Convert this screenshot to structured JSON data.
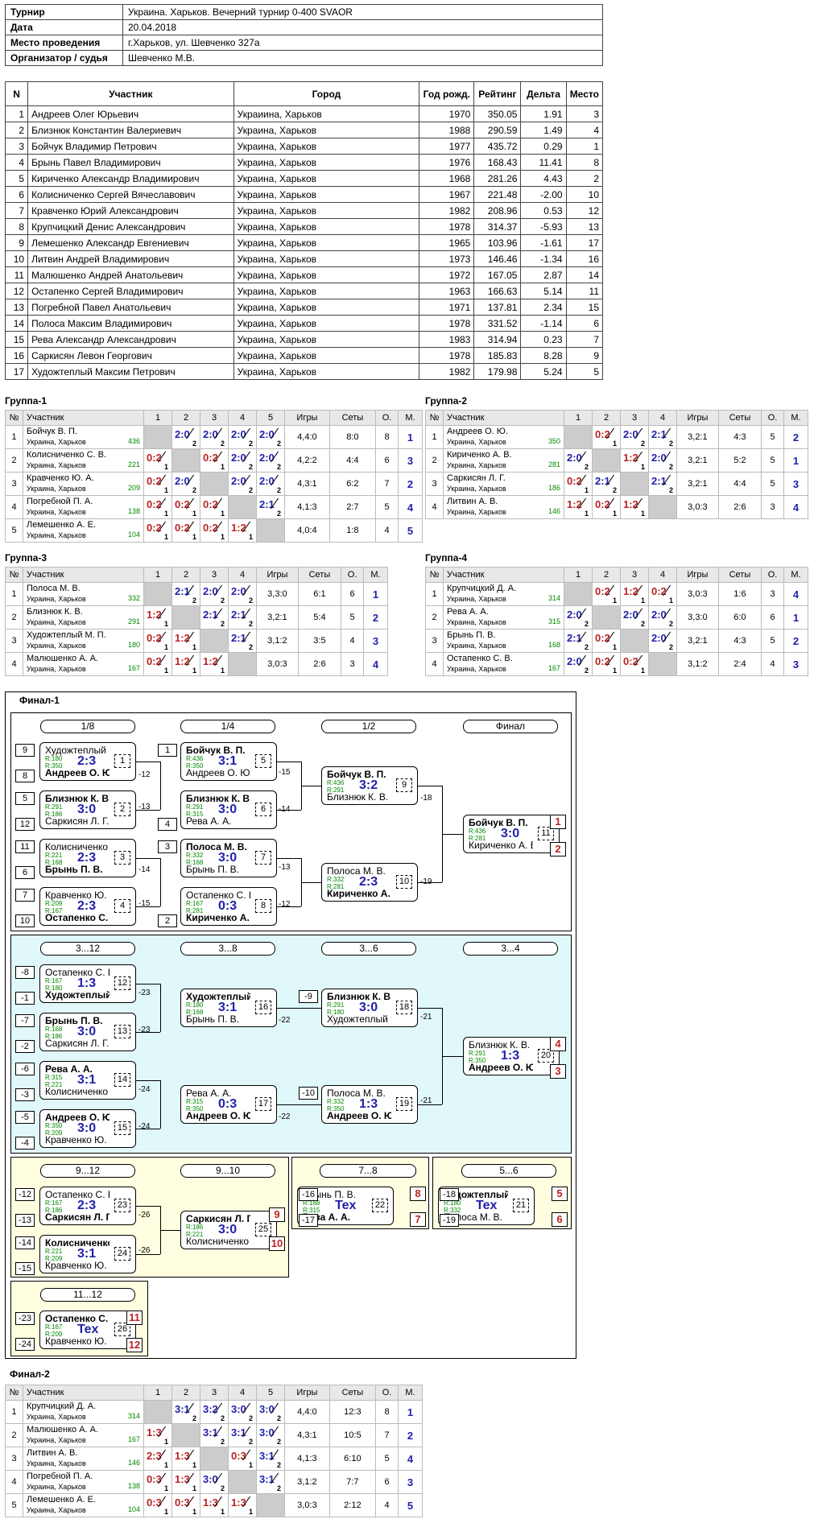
{
  "info": {
    "rows": [
      {
        "k": "Турнир",
        "v": "Украина. Харьков. Вечерний турнир 0-400 SVAOR"
      },
      {
        "k": "Дата",
        "v": "20.04.2018"
      },
      {
        "k": "Место проведения",
        "v": "г.Харьков, ул. Шевченко 327а"
      },
      {
        "k": "Организатор / судья",
        "v": "Шевченко М.В."
      }
    ]
  },
  "participants": {
    "headers": [
      "N",
      "Участник",
      "Город",
      "Год рожд.",
      "Рейтинг",
      "Дельта",
      "Место"
    ],
    "rows": [
      [
        "1",
        "Андреев Олег Юрьевич",
        "Украиина, Харьков",
        "1970",
        "350.05",
        "1.91",
        "3"
      ],
      [
        "2",
        "Близнюк Константин Валериевич",
        "Украина, Харьков",
        "1988",
        "290.59",
        "1.49",
        "4"
      ],
      [
        "3",
        "Бойчук Владимир Петрович",
        "Украина, Харьков",
        "1977",
        "435.72",
        "0.29",
        "1"
      ],
      [
        "4",
        "Брынь Павел Владимирович",
        "Украина, Харьков",
        "1976",
        "168.43",
        "11.41",
        "8"
      ],
      [
        "5",
        "Кириченко Александр Владимирович",
        "Украина, Харьков",
        "1968",
        "281.26",
        "4.43",
        "2"
      ],
      [
        "6",
        "Колисниченко Сергей Вячеславович",
        "Украина, Харьков",
        "1967",
        "221.48",
        "-2.00",
        "10"
      ],
      [
        "7",
        "Кравченко Юрий Александрович",
        "Украина, Харьков",
        "1982",
        "208.96",
        "0.53",
        "12"
      ],
      [
        "8",
        "Крупчицкий Денис Александрович",
        "Украина, Харьков",
        "1978",
        "314.37",
        "-5.93",
        "13"
      ],
      [
        "9",
        "Лемешенко Александр Евгениевич",
        "Украина, Харьков",
        "1965",
        "103.96",
        "-1.61",
        "17"
      ],
      [
        "10",
        "Литвин Андрей Владимирович",
        "Украина, Харьков",
        "1973",
        "146.46",
        "-1.34",
        "16"
      ],
      [
        "11",
        "Малюшенко Андрей Анатольевич",
        "Украина, Харьков",
        "1972",
        "167.05",
        "2.87",
        "14"
      ],
      [
        "12",
        "Остапенко Сергей Владимирович",
        "Украина, Харьков",
        "1963",
        "166.63",
        "5.14",
        "11"
      ],
      [
        "13",
        "Погребной Павел Анатольевич",
        "Украина, Харьков",
        "1971",
        "137.81",
        "2.34",
        "15"
      ],
      [
        "14",
        "Полоса Максим Владимирович",
        "Украина, Харьков",
        "1978",
        "331.52",
        "-1.14",
        "6"
      ],
      [
        "15",
        "Рева Александр Александрович",
        "Украина, Харьков",
        "1983",
        "314.94",
        "0.23",
        "7"
      ],
      [
        "16",
        "Саркисян Левон Георгович",
        "Украина, Харьков",
        "1978",
        "185.83",
        "8.28",
        "9"
      ],
      [
        "17",
        "Художтеплый Максим Петрович",
        "Украина, Харьков",
        "1982",
        "179.98",
        "5.24",
        "5"
      ]
    ]
  },
  "groups": [
    {
      "title": "Группа-1",
      "n": 5,
      "rows": [
        {
          "no": "1",
          "name": "Бойчук В. П.",
          "city": "Украина, Харьков",
          "r": "436",
          "cells": [
            null,
            "2:0|2",
            "2:0|2",
            "2:0|2",
            "2:0|2"
          ],
          "games": "4,4:0",
          "sets": "8:0",
          "o": "8",
          "m": "1"
        },
        {
          "no": "2",
          "name": "Колисниченко С. В.",
          "city": "Украина, Харьков",
          "r": "221",
          "cells": [
            "0:2|1",
            null,
            "0:2|1",
            "2:0|2",
            "2:0|2"
          ],
          "games": "4,2:2",
          "sets": "4:4",
          "o": "6",
          "m": "3"
        },
        {
          "no": "3",
          "name": "Кравченко Ю. А.",
          "city": "Украина, Харьков",
          "r": "209",
          "cells": [
            "0:2|1",
            "2:0|2",
            null,
            "2:0|2",
            "2:0|2"
          ],
          "games": "4,3:1",
          "sets": "6:2",
          "o": "7",
          "m": "2"
        },
        {
          "no": "4",
          "name": "Погребной П. А.",
          "city": "Украина, Харьков",
          "r": "138",
          "cells": [
            "0:2|1",
            "0:2|1",
            "0:2|1",
            null,
            "2:1|2"
          ],
          "games": "4,1:3",
          "sets": "2:7",
          "o": "5",
          "m": "4"
        },
        {
          "no": "5",
          "name": "Лемешенко А. Е.",
          "city": "Украина, Харьков",
          "r": "104",
          "cells": [
            "0:2|1",
            "0:2|1",
            "0:2|1",
            "1:2|1",
            null
          ],
          "games": "4,0:4",
          "sets": "1:8",
          "o": "4",
          "m": "5"
        }
      ]
    },
    {
      "title": "Группа-2",
      "n": 4,
      "rows": [
        {
          "no": "1",
          "name": "Андреев О. Ю.",
          "city": "Украина, Харьков",
          "r": "350",
          "cells": [
            null,
            "0:2|1",
            "2:0|2",
            "2:1|2"
          ],
          "games": "3,2:1",
          "sets": "4:3",
          "o": "5",
          "m": "2"
        },
        {
          "no": "2",
          "name": "Кириченко А. В.",
          "city": "Украина, Харьков",
          "r": "281",
          "cells": [
            "2:0|2",
            null,
            "1:2|1",
            "2:0|2"
          ],
          "games": "3,2:1",
          "sets": "5:2",
          "o": "5",
          "m": "1"
        },
        {
          "no": "3",
          "name": "Саркисян Л. Г.",
          "city": "Украина, Харьков",
          "r": "186",
          "cells": [
            "0:2|1",
            "2:1|2",
            null,
            "2:1|2"
          ],
          "games": "3,2:1",
          "sets": "4:4",
          "o": "5",
          "m": "3"
        },
        {
          "no": "4",
          "name": "Литвин А. В.",
          "city": "Украина, Харьков",
          "r": "146",
          "cells": [
            "1:2|1",
            "0:2|1",
            "1:2|1",
            null
          ],
          "games": "3,0:3",
          "sets": "2:6",
          "o": "3",
          "m": "4"
        }
      ]
    },
    {
      "title": "Группа-3",
      "n": 4,
      "rows": [
        {
          "no": "1",
          "name": "Полоса М. В.",
          "city": "Украина, Харьков",
          "r": "332",
          "cells": [
            null,
            "2:1|2",
            "2:0|2",
            "2:0|2"
          ],
          "games": "3,3:0",
          "sets": "6:1",
          "o": "6",
          "m": "1"
        },
        {
          "no": "2",
          "name": "Близнюк К. В.",
          "city": "Украина, Харьков",
          "r": "291",
          "cells": [
            "1:2|1",
            null,
            "2:1|2",
            "2:1|2"
          ],
          "games": "3,2:1",
          "sets": "5:4",
          "o": "5",
          "m": "2"
        },
        {
          "no": "3",
          "name": "Художтеплый М. П.",
          "city": "Украина, Харьков",
          "r": "180",
          "cells": [
            "0:2|1",
            "1:2|1",
            null,
            "2:1|2"
          ],
          "games": "3,1:2",
          "sets": "3:5",
          "o": "4",
          "m": "3"
        },
        {
          "no": "4",
          "name": "Малюшенко А. А.",
          "city": "Украина, Харьков",
          "r": "167",
          "cells": [
            "0:2|1",
            "1:2|1",
            "1:2|1",
            null
          ],
          "games": "3,0:3",
          "sets": "2:6",
          "o": "3",
          "m": "4"
        }
      ]
    },
    {
      "title": "Группа-4",
      "n": 4,
      "rows": [
        {
          "no": "1",
          "name": "Крупчицкий Д. А.",
          "city": "Украина, Харьков",
          "r": "314",
          "cells": [
            null,
            "0:2|1",
            "1:2|1",
            "0:2|1"
          ],
          "games": "3,0:3",
          "sets": "1:6",
          "o": "3",
          "m": "4"
        },
        {
          "no": "2",
          "name": "Рева А. А.",
          "city": "Украина, Харьков",
          "r": "315",
          "cells": [
            "2:0|2",
            null,
            "2:0|2",
            "2:0|2"
          ],
          "games": "3,3:0",
          "sets": "6:0",
          "o": "6",
          "m": "1"
        },
        {
          "no": "3",
          "name": "Брынь П. В.",
          "city": "Украина, Харьков",
          "r": "168",
          "cells": [
            "2:1|2",
            "0:2|1",
            null,
            "2:0|2"
          ],
          "games": "3,2:1",
          "sets": "4:3",
          "o": "5",
          "m": "2"
        },
        {
          "no": "4",
          "name": "Остапенко С. В.",
          "city": "Украина, Харьков",
          "r": "167",
          "cells": [
            "2:0|2",
            "0:2|1",
            "0:2|1",
            null
          ],
          "games": "3,1:2",
          "sets": "2:4",
          "o": "4",
          "m": "3"
        }
      ]
    },
    {
      "title": "Финал-2",
      "n": 5,
      "rows": [
        {
          "no": "1",
          "name": "Крупчицкий Д. А.",
          "city": "Украина, Харьков",
          "r": "314",
          "cells": [
            null,
            "3:1|2",
            "3:2|2",
            "3:0|2",
            "3:0|2"
          ],
          "games": "4,4:0",
          "sets": "12:3",
          "o": "8",
          "m": "1"
        },
        {
          "no": "2",
          "name": "Малюшенко А. А.",
          "city": "Украина, Харьков",
          "r": "167",
          "cells": [
            "1:3|1",
            null,
            "3:1|2",
            "3:1|2",
            "3:0|2"
          ],
          "games": "4,3:1",
          "sets": "10:5",
          "o": "7",
          "m": "2"
        },
        {
          "no": "3",
          "name": "Литвин А. В.",
          "city": "Украина, Харьков",
          "r": "146",
          "cells": [
            "2:3|1",
            "1:3|1",
            null,
            "0:3|1",
            "3:1|2"
          ],
          "games": "4,1:3",
          "sets": "6:10",
          "o": "5",
          "m": "4"
        },
        {
          "no": "4",
          "name": "Погребной П. А.",
          "city": "Украина, Харьков",
          "r": "138",
          "cells": [
            "0:3|1",
            "1:3|1",
            "3:0|2",
            null,
            "3:1|2"
          ],
          "games": "3,1:2",
          "sets": "7:7",
          "o": "6",
          "m": "3"
        },
        {
          "no": "5",
          "name": "Лемешенко А. Е.",
          "city": "Украина, Харьков",
          "r": "104",
          "cells": [
            "0:3|1",
            "0:3|1",
            "1:3|1",
            "1:3|1",
            null
          ],
          "games": "3,0:3",
          "sets": "2:12",
          "o": "4",
          "m": "5"
        }
      ]
    }
  ],
  "group_headers": {
    "n": "№",
    "name": "Участник",
    "games": "Игры",
    "sets": "Сеты",
    "o": "О.",
    "m": "М."
  },
  "final1": {
    "title": "Финал-1",
    "rounds": [
      "1/8",
      "1/4",
      "1/2",
      "Финал",
      "3...12",
      "3...8",
      "3...6",
      "3...4",
      "9...12",
      "9...10",
      "7...8",
      "5...6",
      "11...12"
    ],
    "matches": [
      {
        "p1": "Художтеплый М...",
        "p2": "Андреев О. Ю.",
        "r1": "R:180",
        "r2": "R:350",
        "s": "2:3",
        "n": "1",
        "b": 2
      },
      {
        "p1": "Близнюк К. В.",
        "p2": "Саркисян Л. Г.",
        "r1": "R:291",
        "r2": "R:186",
        "s": "3:0",
        "n": "2",
        "b": 1
      },
      {
        "p1": "Колисниченко ...",
        "p2": "Брынь П. В.",
        "r1": "R:221",
        "r2": "R:168",
        "s": "2:3",
        "n": "3",
        "b": 2
      },
      {
        "p1": "Кравченко Ю. А.",
        "p2": "Остапенко С. В.",
        "r1": "R:209",
        "r2": "R:167",
        "s": "2:3",
        "n": "4",
        "b": 2
      },
      {
        "p1": "Бойчук В. П.",
        "p2": "Андреев О. Ю.",
        "r1": "R:436",
        "r2": "R:350",
        "s": "3:1",
        "n": "5",
        "b": 1
      },
      {
        "p1": "Близнюк К. В.",
        "p2": "Рева А. А.",
        "r1": "R:291",
        "r2": "R:315",
        "s": "3:0",
        "n": "6",
        "b": 1
      },
      {
        "p1": "Полоса М. В.",
        "p2": "Брынь П. В.",
        "r1": "R:332",
        "r2": "R:168",
        "s": "3:0",
        "n": "7",
        "b": 1
      },
      {
        "p1": "Остапенко С. В.",
        "p2": "Кириченко А. В.",
        "r1": "R:167",
        "r2": "R:281",
        "s": "0:3",
        "n": "8",
        "b": 2
      },
      {
        "p1": "Бойчук В. П.",
        "p2": "Близнюк К. В.",
        "r1": "R:436",
        "r2": "R:291",
        "s": "3:2",
        "n": "9",
        "b": 1
      },
      {
        "p1": "Полоса М. В.",
        "p2": "Кириченко А. В.",
        "r1": "R:332",
        "r2": "R:281",
        "s": "2:3",
        "n": "10",
        "b": 2
      },
      {
        "p1": "Бойчук В. П.",
        "p2": "Кириченко А. В.",
        "r1": "R:436",
        "r2": "R:281",
        "s": "3:0",
        "n": "11",
        "b": 1
      },
      {
        "p1": "Остапенко С. В.",
        "p2": "Художтеплый М...",
        "r1": "R:167",
        "r2": "R:180",
        "s": "1:3",
        "n": "12",
        "b": 2
      },
      {
        "p1": "Брынь П. В.",
        "p2": "Саркисян Л. Г.",
        "r1": "R:168",
        "r2": "R:186",
        "s": "3:0",
        "n": "13",
        "b": 1
      },
      {
        "p1": "Рева А. А.",
        "p2": "Колисниченко ...",
        "r1": "R:315",
        "r2": "R:221",
        "s": "3:1",
        "n": "14",
        "b": 1
      },
      {
        "p1": "Андреев О. Ю.",
        "p2": "Кравченко Ю. А.",
        "r1": "R:350",
        "r2": "R:209",
        "s": "3:0",
        "n": "15",
        "b": 1
      },
      {
        "p1": "Художтеплый М...",
        "p2": "Брынь П. В.",
        "r1": "R:180",
        "r2": "R:168",
        "s": "3:1",
        "n": "16",
        "b": 1
      },
      {
        "p1": "Рева А. А.",
        "p2": "Андреев О. Ю.",
        "r1": "R:315",
        "r2": "R:350",
        "s": "0:3",
        "n": "17",
        "b": 2
      },
      {
        "p1": "Близнюк К. В.",
        "p2": "Художтеплый М...",
        "r1": "R:291",
        "r2": "R:180",
        "s": "3:0",
        "n": "18",
        "b": 1
      },
      {
        "p1": "Полоса М. В.",
        "p2": "Андреев О. Ю.",
        "r1": "R:332",
        "r2": "R:350",
        "s": "1:3",
        "n": "19",
        "b": 2
      },
      {
        "p1": "Близнюк К. В.",
        "p2": "Андреев О. Ю.",
        "r1": "R:291",
        "r2": "R:350",
        "s": "1:3",
        "n": "20",
        "b": 2
      },
      {
        "p1": "Саркисян Л. Г.",
        "p2": "Колисниченко ...",
        "r1": "R:186",
        "r2": "R:221",
        "s": "3:0",
        "n": "25",
        "b": 1
      },
      {
        "p1": "Остапенко С. В.",
        "p2": "Саркисян Л. Г.",
        "r1": "R:167",
        "r2": "R:186",
        "s": "2:3",
        "n": "23",
        "b": 2
      },
      {
        "p1": "Колисниченко ...",
        "p2": "Кравченко Ю. А.",
        "r1": "R:221",
        "r2": "R:209",
        "s": "3:1",
        "n": "24",
        "b": 1
      },
      {
        "p1": "Брынь П. В.",
        "p2": "Рева А. А.",
        "r1": "R:168",
        "r2": "R:315",
        "s": "Tex",
        "n": "22",
        "b": 2
      },
      {
        "p1": "Художтеплый М...",
        "p2": "Полоса М. В.",
        "r1": "R:180",
        "r2": "R:332",
        "s": "Tex",
        "n": "21",
        "b": 1
      },
      {
        "p1": "Остапенко С. В.",
        "p2": "Кравченко Ю. А.",
        "r1": "R:167",
        "r2": "R:209",
        "s": "Tex",
        "n": "26",
        "b": 1
      }
    ],
    "seeds": [
      "9",
      "8",
      "5",
      "12",
      "11",
      "6",
      "7",
      "10",
      "1",
      "4",
      "3",
      "2",
      "-8",
      "-1",
      "-7",
      "-2",
      "-6",
      "-3",
      "-5",
      "-4",
      "-9",
      "-10",
      "-12",
      "-13",
      "-14",
      "-15",
      "-16",
      "-17",
      "-18",
      "-19",
      "-23",
      "-24"
    ],
    "lbls": [
      "-12",
      "-13",
      "-14",
      "-15",
      "-15",
      "-14",
      "-13",
      "-12",
      "-18",
      "-19",
      "-23",
      "-23",
      "-24",
      "-24",
      "-22",
      "-22",
      "-21",
      "-21",
      "-26",
      "-26"
    ],
    "places": [
      "1",
      "2",
      "4",
      "3",
      "9",
      "10",
      "8",
      "7",
      "5",
      "6",
      "11",
      "12"
    ]
  }
}
